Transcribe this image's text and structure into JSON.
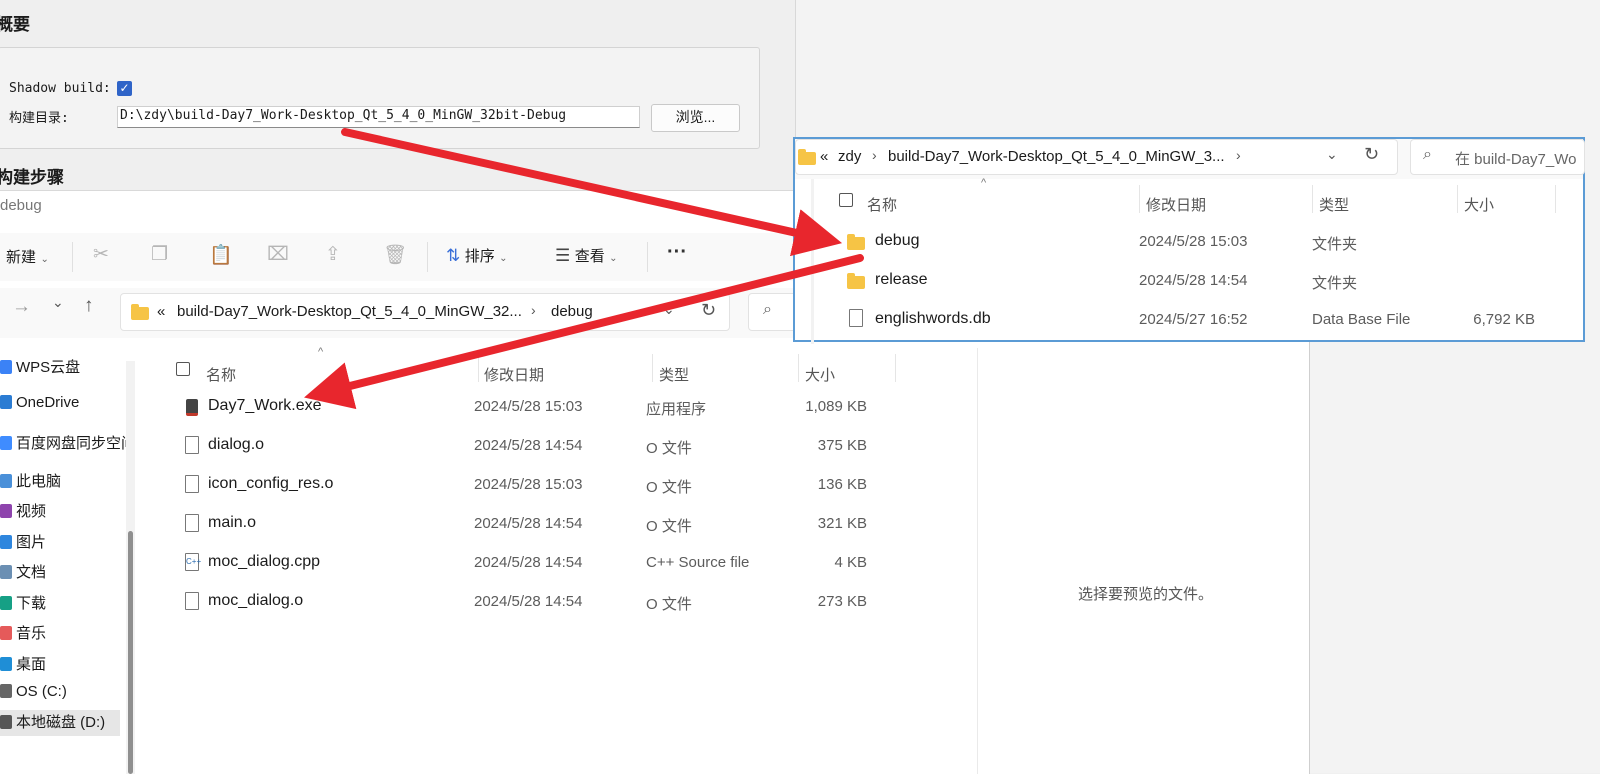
{
  "qt_panel": {
    "section_overview": "概要",
    "shadow_build_label": "Shadow build:",
    "shadow_build_checked": true,
    "build_dir_label": "构建目录:",
    "build_dir_value": "D:\\zdy\\build-Day7_Work-Desktop_Qt_5_4_0_MinGW_32bit-Debug",
    "browse_label": "浏览...",
    "section_build_steps": "构建步骤"
  },
  "explorer": {
    "window_title": "debug",
    "toolbar": {
      "new_label": "新建",
      "sort_label": "排序",
      "view_label": "查看",
      "more_label": "···"
    },
    "address": {
      "chevrons": "«",
      "path_parent": "build-Day7_Work-Desktop_Qt_5_4_0_MinGW_32...",
      "path_current": "debug"
    },
    "sidebar": [
      {
        "label": "WPS云盘",
        "color": "#3b82f6"
      },
      {
        "label": "OneDrive",
        "color": "#2b7cd3"
      },
      {
        "label": "百度网盘同步空间",
        "color": "#3f8cff"
      },
      {
        "label": "此电脑",
        "color": "#4a90d9"
      },
      {
        "label": "视频",
        "color": "#8e44ad"
      },
      {
        "label": "图片",
        "color": "#2e86de"
      },
      {
        "label": "文档",
        "color": "#6b8fb3"
      },
      {
        "label": "下载",
        "color": "#16a085"
      },
      {
        "label": "音乐",
        "color": "#e55a5a"
      },
      {
        "label": "桌面",
        "color": "#1f8ed6"
      },
      {
        "label": "OS (C:)",
        "color": "#666666"
      },
      {
        "label": "本地磁盘 (D:)",
        "color": "#555555"
      }
    ],
    "columns": {
      "name": "名称",
      "modified": "修改日期",
      "type": "类型",
      "size": "大小"
    },
    "files": [
      {
        "name": "Day7_Work.exe",
        "modified": "2024/5/28 15:03",
        "type": "应用程序",
        "size": "1,089 KB",
        "icon": "exe-icon"
      },
      {
        "name": "dialog.o",
        "modified": "2024/5/28 14:54",
        "type": "O 文件",
        "size": "375 KB",
        "icon": "file-icon"
      },
      {
        "name": "icon_config_res.o",
        "modified": "2024/5/28 15:03",
        "type": "O 文件",
        "size": "136 KB",
        "icon": "file-icon"
      },
      {
        "name": "main.o",
        "modified": "2024/5/28 14:54",
        "type": "O 文件",
        "size": "321 KB",
        "icon": "file-icon"
      },
      {
        "name": "moc_dialog.cpp",
        "modified": "2024/5/28 14:54",
        "type": "C++ Source file",
        "size": "4 KB",
        "icon": "cpp-file-icon"
      },
      {
        "name": "moc_dialog.o",
        "modified": "2024/5/28 14:54",
        "type": "O 文件",
        "size": "273 KB",
        "icon": "file-icon"
      }
    ],
    "preview_text": "选择要预览的文件。"
  },
  "popup": {
    "path_chevrons": "«",
    "path_root": "zdy",
    "path_child": "build-Day7_Work-Desktop_Qt_5_4_0_MinGW_3...",
    "search_placeholder": "在 build-Day7_Wo",
    "columns": {
      "name": "名称",
      "modified": "修改日期",
      "type": "类型",
      "size": "大小"
    },
    "items": [
      {
        "name": "debug",
        "modified": "2024/5/28 15:03",
        "type": "文件夹",
        "size": ""
      },
      {
        "name": "release",
        "modified": "2024/5/28 14:54",
        "type": "文件夹",
        "size": ""
      },
      {
        "name": "englishwords.db",
        "modified": "2024/5/27 16:52",
        "type": "Data Base File",
        "size": "6,792 KB"
      }
    ]
  },
  "annotation_color": "#e8262d"
}
